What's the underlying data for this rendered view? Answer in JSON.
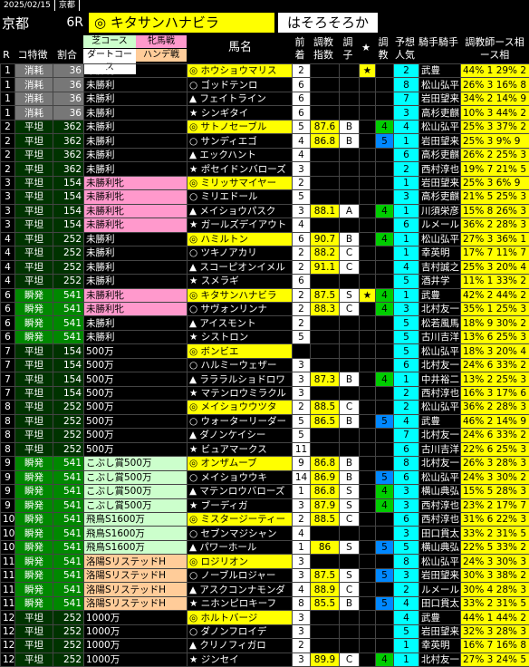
{
  "header": {
    "date": "2025/02/15",
    "venue_small": "京都",
    "venue": "京都",
    "race": "6R",
    "featured_horse": "◎ キタサンハナビラ",
    "comment": "はそろそろか"
  },
  "columns": {
    "r": "R",
    "course": "コ特徴",
    "ratio": "割合",
    "turf": "芝コース",
    "dirt": "ダートコース",
    "sex": "牝馬戦",
    "handicap": "ハンデ戦",
    "horse": "馬名",
    "prev": "前着",
    "idx": "調教指数",
    "cond": "調子",
    "star": "★",
    "training": "調教",
    "pop": "予想人気",
    "jockey": "騎手騎手",
    "trainer": "調教師ース相ース相"
  },
  "rows": [
    {
      "r": "1",
      "course": "消耗",
      "ratio": "36",
      "cls": "未勝利",
      "mark": "◎",
      "horse": "ホウショウマリス",
      "prev": "2",
      "idx": "",
      "cond": "",
      "star": "★",
      "train": "",
      "pop": "2",
      "jockey": "武豊",
      "trainer": "44% 1 29% 2"
    },
    {
      "r": "1",
      "course": "消耗",
      "ratio": "36",
      "cls": "未勝利",
      "mark": "○",
      "horse": "ゴッドテンロ",
      "prev": "6",
      "idx": "",
      "cond": "",
      "star": "",
      "train": "",
      "pop": "8",
      "jockey": "松山弘平",
      "trainer": "26% 3 16% 8"
    },
    {
      "r": "1",
      "course": "消耗",
      "ratio": "36",
      "cls": "未勝利",
      "mark": "▲",
      "horse": "フェイトライン",
      "prev": "6",
      "idx": "",
      "cond": "",
      "star": "",
      "train": "",
      "pop": "7",
      "jockey": "岩田望来",
      "trainer": "34% 2 14% 9"
    },
    {
      "r": "1",
      "course": "消耗",
      "ratio": "36",
      "cls": "未勝利",
      "mark": "★",
      "horse": "シンギタイ",
      "prev": "6",
      "idx": "",
      "cond": "",
      "star": "",
      "train": "",
      "pop": "3",
      "jockey": "高杉吏麒",
      "trainer": "10% 3 44% 2"
    },
    {
      "r": "2",
      "course": "平坦",
      "ratio": "362",
      "cls": "未勝利",
      "mark": "◎",
      "horse": "サトノセーブル",
      "prev": "5",
      "idx": "87.6",
      "cond": "B",
      "star": "",
      "train": "4",
      "pop": "4",
      "jockey": "松山弘平",
      "trainer": "25% 3 37% 2"
    },
    {
      "r": "2",
      "course": "平坦",
      "ratio": "362",
      "cls": "未勝利",
      "mark": "○",
      "horse": "サンディエゴ",
      "prev": "4",
      "idx": "86.8",
      "cond": "B",
      "star": "",
      "train": "5",
      "pop": "1",
      "jockey": "岩田望来",
      "trainer": "25% 3 9% 9"
    },
    {
      "r": "2",
      "course": "平坦",
      "ratio": "362",
      "cls": "未勝利",
      "mark": "▲",
      "horse": "エックハント",
      "prev": "4",
      "idx": "",
      "cond": "",
      "star": "",
      "train": "",
      "pop": "6",
      "jockey": "高杉吏麒",
      "trainer": "26% 2 25% 3"
    },
    {
      "r": "2",
      "course": "平坦",
      "ratio": "362",
      "cls": "未勝利",
      "mark": "★",
      "horse": "ポセイドンバローズ",
      "prev": "3",
      "idx": "",
      "cond": "",
      "star": "",
      "train": "",
      "pop": "2",
      "jockey": "西村淳也",
      "trainer": "19% 7 21% 5"
    },
    {
      "r": "3",
      "course": "平坦",
      "ratio": "154",
      "cls": "未勝利牝",
      "mark": "◎",
      "horse": "ミリッサマイヤー",
      "prev": "2",
      "idx": "",
      "cond": "",
      "star": "",
      "train": "",
      "pop": "1",
      "jockey": "岩田望来",
      "trainer": "25% 3 6% 9"
    },
    {
      "r": "3",
      "course": "平坦",
      "ratio": "154",
      "cls": "未勝利牝",
      "mark": "○",
      "horse": "ミリエドール",
      "prev": "5",
      "idx": "",
      "cond": "",
      "star": "",
      "train": "",
      "pop": "3",
      "jockey": "高杉吏麒",
      "trainer": "21% 5 25% 3"
    },
    {
      "r": "3",
      "course": "平坦",
      "ratio": "154",
      "cls": "未勝利牝",
      "mark": "▲",
      "horse": "メイショウパスク",
      "prev": "3",
      "idx": "88.1",
      "cond": "A",
      "star": "",
      "train": "4",
      "pop": "1",
      "jockey": "川須栄彦",
      "trainer": "15% 8 26% 3"
    },
    {
      "r": "3",
      "course": "平坦",
      "ratio": "154",
      "cls": "未勝利牝",
      "mark": "★",
      "horse": "ガールズデイアウト",
      "prev": "4",
      "idx": "",
      "cond": "",
      "star": "",
      "train": "",
      "pop": "6",
      "jockey": "ルメール",
      "trainer": "36% 2 28% 3"
    },
    {
      "r": "4",
      "course": "平坦",
      "ratio": "252",
      "cls": "未勝利",
      "mark": "◎",
      "horse": "ハミルトン",
      "prev": "6",
      "idx": "90.7",
      "cond": "B",
      "star": "",
      "train": "4",
      "pop": "1",
      "jockey": "松山弘平",
      "trainer": "27% 3 36% 1"
    },
    {
      "r": "4",
      "course": "平坦",
      "ratio": "252",
      "cls": "未勝利",
      "mark": "○",
      "horse": "ツキノアカリ",
      "prev": "2",
      "idx": "88.2",
      "cond": "C",
      "star": "",
      "train": "",
      "pop": "1",
      "jockey": "幸英明",
      "trainer": "17% 7 11% 7"
    },
    {
      "r": "4",
      "course": "平坦",
      "ratio": "252",
      "cls": "未勝利",
      "mark": "▲",
      "horse": "スコーピオンイメル",
      "prev": "2",
      "idx": "91.1",
      "cond": "C",
      "star": "",
      "train": "",
      "pop": "4",
      "jockey": "吉村誠之",
      "trainer": "25% 3 20% 4"
    },
    {
      "r": "4",
      "course": "平坦",
      "ratio": "252",
      "cls": "未勝利",
      "mark": "★",
      "horse": "スメラギ",
      "prev": "6",
      "idx": "",
      "cond": "",
      "star": "",
      "train": "",
      "pop": "5",
      "jockey": "酒井学",
      "trainer": "11% 1 33% 2"
    },
    {
      "r": "6",
      "course": "瞬発",
      "ratio": "541",
      "cls": "未勝利牝",
      "mark": "◎",
      "horse": "キタサンハナビラ",
      "prev": "2",
      "idx": "87.5",
      "cond": "S",
      "star": "★",
      "train": "4",
      "pop": "1",
      "jockey": "武豊",
      "trainer": "42% 2 44% 2"
    },
    {
      "r": "6",
      "course": "瞬発",
      "ratio": "541",
      "cls": "未勝利牝",
      "mark": "○",
      "horse": "サヴォンリンナ",
      "prev": "2",
      "idx": "88.3",
      "cond": "C",
      "star": "",
      "train": "4",
      "pop": "3",
      "jockey": "北村友一",
      "trainer": "35% 1 25% 3"
    },
    {
      "r": "6",
      "course": "瞬発",
      "ratio": "541",
      "cls": "未勝利",
      "mark": "▲",
      "horse": "アイスモント",
      "prev": "2",
      "idx": "",
      "cond": "",
      "star": "",
      "train": "",
      "pop": "5",
      "jockey": "松若風馬",
      "trainer": "18% 9 30% 2"
    },
    {
      "r": "6",
      "course": "瞬発",
      "ratio": "541",
      "cls": "未勝利",
      "mark": "★",
      "horse": "シストロン",
      "prev": "5",
      "idx": "",
      "cond": "",
      "star": "",
      "train": "",
      "pop": "5",
      "jockey": "古川吉洋",
      "trainer": "13% 6 25% 3"
    },
    {
      "r": "7",
      "course": "平坦",
      "ratio": "154",
      "cls": "500万",
      "mark": "◎",
      "horse": "ボンビエ",
      "prev": "",
      "idx": "",
      "cond": "",
      "star": "",
      "train": "",
      "pop": "5",
      "jockey": "松山弘平",
      "trainer": "18% 3 20% 4"
    },
    {
      "r": "7",
      "course": "平坦",
      "ratio": "154",
      "cls": "500万",
      "mark": "○",
      "horse": "ハルミーウェザー",
      "prev": "3",
      "idx": "",
      "cond": "",
      "star": "",
      "train": "",
      "pop": "6",
      "jockey": "北村友一",
      "trainer": "24% 6 33% 2"
    },
    {
      "r": "7",
      "course": "平坦",
      "ratio": "154",
      "cls": "500万",
      "mark": "▲",
      "horse": "ラララルショドロワ",
      "prev": "3",
      "idx": "87.3",
      "cond": "B",
      "star": "",
      "train": "4",
      "pop": "1",
      "jockey": "中井裕二",
      "trainer": "13% 2 25% 3"
    },
    {
      "r": "7",
      "course": "平坦",
      "ratio": "154",
      "cls": "500万",
      "mark": "★",
      "horse": "マテンロウミラクル",
      "prev": "3",
      "idx": "",
      "cond": "",
      "star": "",
      "train": "",
      "pop": "2",
      "jockey": "西村淳也",
      "trainer": "16% 3 17% 6"
    },
    {
      "r": "8",
      "course": "平坦",
      "ratio": "252",
      "cls": "500万",
      "mark": "◎",
      "horse": "メイショウウツタ",
      "prev": "2",
      "idx": "88.5",
      "cond": "C",
      "star": "",
      "train": "",
      "pop": "2",
      "jockey": "松山弘平",
      "trainer": "36% 2 28% 3"
    },
    {
      "r": "8",
      "course": "平坦",
      "ratio": "252",
      "cls": "500万",
      "mark": "○",
      "horse": "ウォーターリーダー",
      "prev": "5",
      "idx": "86.5",
      "cond": "B",
      "star": "",
      "train": "5",
      "pop": "4",
      "jockey": "武豊",
      "trainer": "46% 2 14% 9"
    },
    {
      "r": "8",
      "course": "平坦",
      "ratio": "252",
      "cls": "500万",
      "mark": "▲",
      "horse": "ダノンケイシー",
      "prev": "5",
      "idx": "",
      "cond": "",
      "star": "",
      "train": "",
      "pop": "7",
      "jockey": "北村友一",
      "trainer": "24% 6 33% 2"
    },
    {
      "r": "8",
      "course": "平坦",
      "ratio": "252",
      "cls": "500万",
      "mark": "★",
      "horse": "ビュアマークス",
      "prev": "11",
      "idx": "",
      "cond": "",
      "star": "",
      "train": "",
      "pop": "6",
      "jockey": "古川吉洋",
      "trainer": "22% 6 25% 3"
    },
    {
      "r": "9",
      "course": "瞬発",
      "ratio": "541",
      "cls": "こぶし賞500万",
      "mark": "◎",
      "horse": "オンザムーブ",
      "prev": "9",
      "idx": "86.8",
      "cond": "B",
      "star": "",
      "train": "",
      "pop": "8",
      "jockey": "北村友一",
      "trainer": "26% 3 28% 3"
    },
    {
      "r": "9",
      "course": "瞬発",
      "ratio": "541",
      "cls": "こぶし賞500万",
      "mark": "○",
      "horse": "メイショウウキ",
      "prev": "14",
      "idx": "86.9",
      "cond": "B",
      "star": "",
      "train": "5",
      "pop": "6",
      "jockey": "松山弘平",
      "trainer": "24% 3 30% 2"
    },
    {
      "r": "9",
      "course": "瞬発",
      "ratio": "541",
      "cls": "こぶし賞500万",
      "mark": "▲",
      "horse": "マテンロウバローズ",
      "prev": "1",
      "idx": "86.8",
      "cond": "S",
      "star": "",
      "train": "4",
      "pop": "3",
      "jockey": "横山典弘",
      "trainer": "15% 5 28% 3"
    },
    {
      "r": "9",
      "course": "瞬発",
      "ratio": "541",
      "cls": "こぶし賞500万",
      "mark": "★",
      "horse": "ブーディガ",
      "prev": "3",
      "idx": "87.9",
      "cond": "S",
      "star": "",
      "train": "4",
      "pop": "3",
      "jockey": "西村淳也",
      "trainer": "23% 2 17% 7"
    },
    {
      "r": "10",
      "course": "瞬発",
      "ratio": "541",
      "cls": "飛鳥S1600万",
      "mark": "◎",
      "horse": "ミスタージーティー",
      "prev": "2",
      "idx": "88.5",
      "cond": "C",
      "star": "",
      "train": "",
      "pop": "6",
      "jockey": "西村淳也",
      "trainer": "31% 6 22% 3"
    },
    {
      "r": "10",
      "course": "瞬発",
      "ratio": "541",
      "cls": "飛鳥S1600万",
      "mark": "○",
      "horse": "セブンマジシャン",
      "prev": "4",
      "idx": "",
      "cond": "",
      "star": "",
      "train": "",
      "pop": "3",
      "jockey": "田口貫太",
      "trainer": "33% 2 31% 5"
    },
    {
      "r": "10",
      "course": "瞬発",
      "ratio": "541",
      "cls": "飛鳥S1600万",
      "mark": "▲",
      "horse": "パワーホール",
      "prev": "1",
      "idx": "86",
      "cond": "S",
      "star": "",
      "train": "5",
      "pop": "5",
      "jockey": "横山典弘",
      "trainer": "22% 5 33% 2"
    },
    {
      "r": "11",
      "course": "瞬発",
      "ratio": "541",
      "cls": "洛陽SリステッドH",
      "mark": "◎",
      "horse": "ロジリオン",
      "prev": "3",
      "idx": "",
      "cond": "",
      "star": "",
      "train": "",
      "pop": "8",
      "jockey": "松山弘平",
      "trainer": "24% 3 30% 3"
    },
    {
      "r": "11",
      "course": "瞬発",
      "ratio": "541",
      "cls": "洛陽SリステッドH",
      "mark": "○",
      "horse": "ノーブルロジャー",
      "prev": "3",
      "idx": "87.5",
      "cond": "S",
      "star": "",
      "train": "5",
      "pop": "3",
      "jockey": "岩田望来",
      "trainer": "30% 3 38% 2"
    },
    {
      "r": "11",
      "course": "瞬発",
      "ratio": "541",
      "cls": "洛陽SリステッドH",
      "mark": "▲",
      "horse": "アスクコンナモンダ",
      "prev": "4",
      "idx": "88.9",
      "cond": "C",
      "star": "",
      "train": "",
      "pop": "2",
      "jockey": "ルメール",
      "trainer": "30% 4 28% 3"
    },
    {
      "r": "11",
      "course": "瞬発",
      "ratio": "541",
      "cls": "洛陽SリステッドH",
      "mark": "★",
      "horse": "ニホンピロキーフ",
      "prev": "8",
      "idx": "85.5",
      "cond": "B",
      "star": "",
      "train": "5",
      "pop": "4",
      "jockey": "田口貫太",
      "trainer": "33% 2 31% 5"
    },
    {
      "r": "12",
      "course": "平坦",
      "ratio": "252",
      "cls": "1000万",
      "mark": "◎",
      "horse": "ホルトバージ",
      "prev": "3",
      "idx": "",
      "cond": "",
      "star": "",
      "train": "",
      "pop": "4",
      "jockey": "武豊",
      "trainer": "44% 1 44% 2"
    },
    {
      "r": "12",
      "course": "平坦",
      "ratio": "252",
      "cls": "1000万",
      "mark": "○",
      "horse": "ダノンフロイデ",
      "prev": "3",
      "idx": "",
      "cond": "",
      "star": "",
      "train": "",
      "pop": "5",
      "jockey": "岩田望来",
      "trainer": "32% 3 28% 3"
    },
    {
      "r": "12",
      "course": "平坦",
      "ratio": "252",
      "cls": "1000万",
      "mark": "▲",
      "horse": "クリノフィガロ",
      "prev": "2",
      "idx": "",
      "cond": "",
      "star": "",
      "train": "",
      "pop": "1",
      "jockey": "幸英明",
      "trainer": "16% 7 16% 8"
    },
    {
      "r": "12",
      "course": "平坦",
      "ratio": "252",
      "cls": "1000万",
      "mark": "★",
      "horse": "ジンセイ",
      "prev": "3",
      "idx": "89.9",
      "cond": "C",
      "star": "",
      "train": "4",
      "pop": "1",
      "jockey": "北村友一",
      "trainer": "27% 3 24% 5"
    }
  ]
}
